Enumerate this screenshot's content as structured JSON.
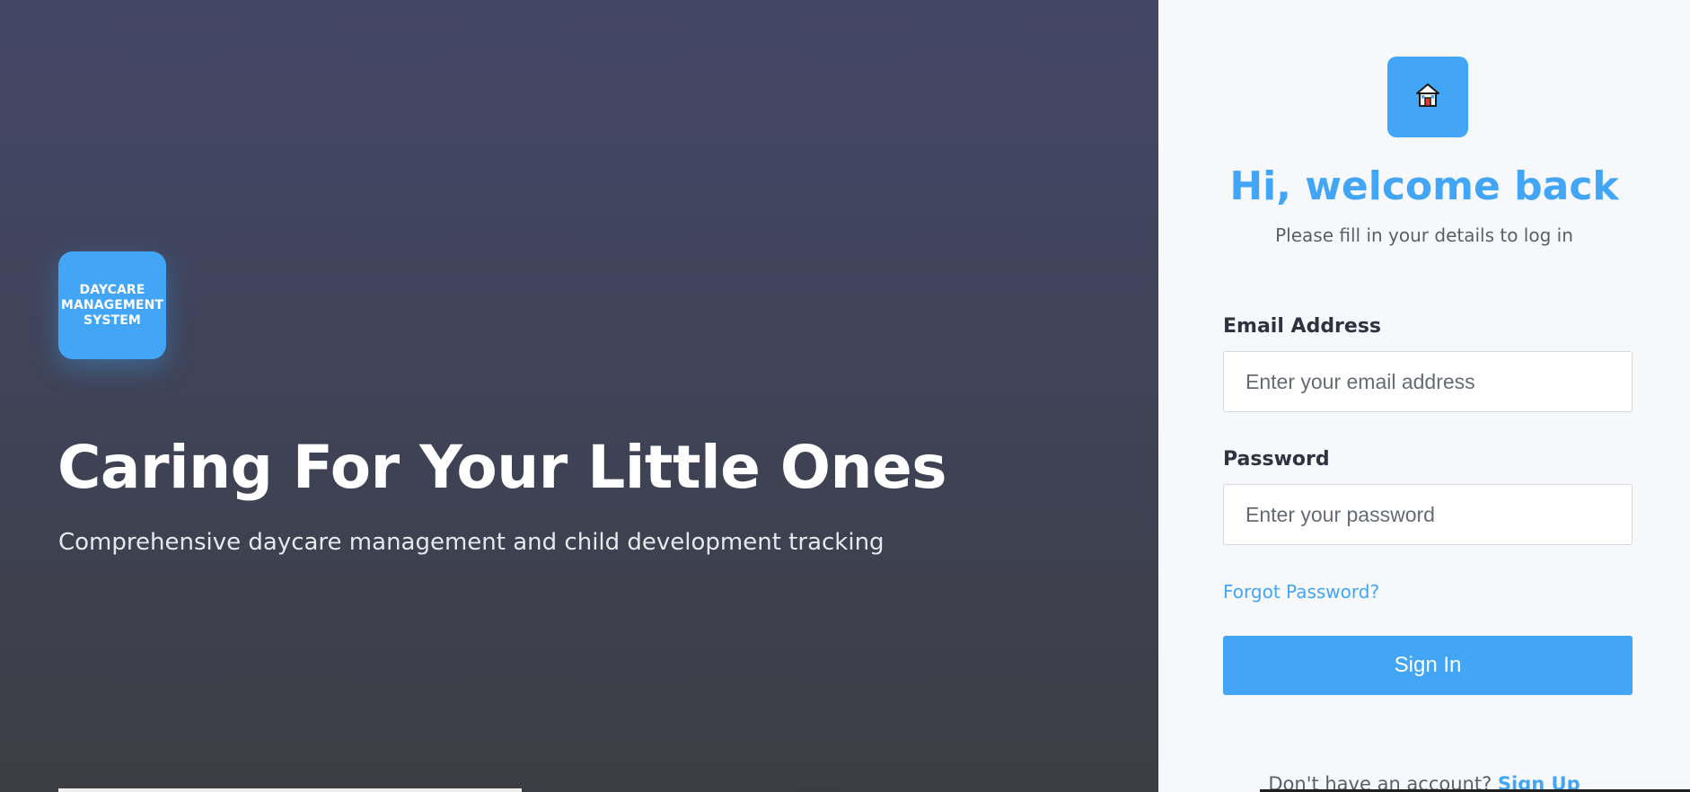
{
  "hero": {
    "logo_text": "DAYCARE MANAGEMENT SYSTEM",
    "title": "Caring For Your Little Ones",
    "subtitle": "Comprehensive daycare management and child development tracking"
  },
  "login": {
    "icon": "house-icon",
    "heading": "Hi, welcome back",
    "subheading": "Please fill in your details to log in",
    "email_label": "Email Address",
    "email_placeholder": "Enter your email address",
    "email_value": "",
    "password_label": "Password",
    "password_placeholder": "Enter your password",
    "password_value": "",
    "forgot_label": "Forgot Password?",
    "signin_label": "Sign In",
    "signup_prompt": "Don't have an account?",
    "signup_label": "Sign Up"
  },
  "colors": {
    "accent": "#42a5f5",
    "hero_top": "#434766",
    "hero_bottom": "#3d3d44",
    "panel_bg": "#f7f8fb"
  }
}
